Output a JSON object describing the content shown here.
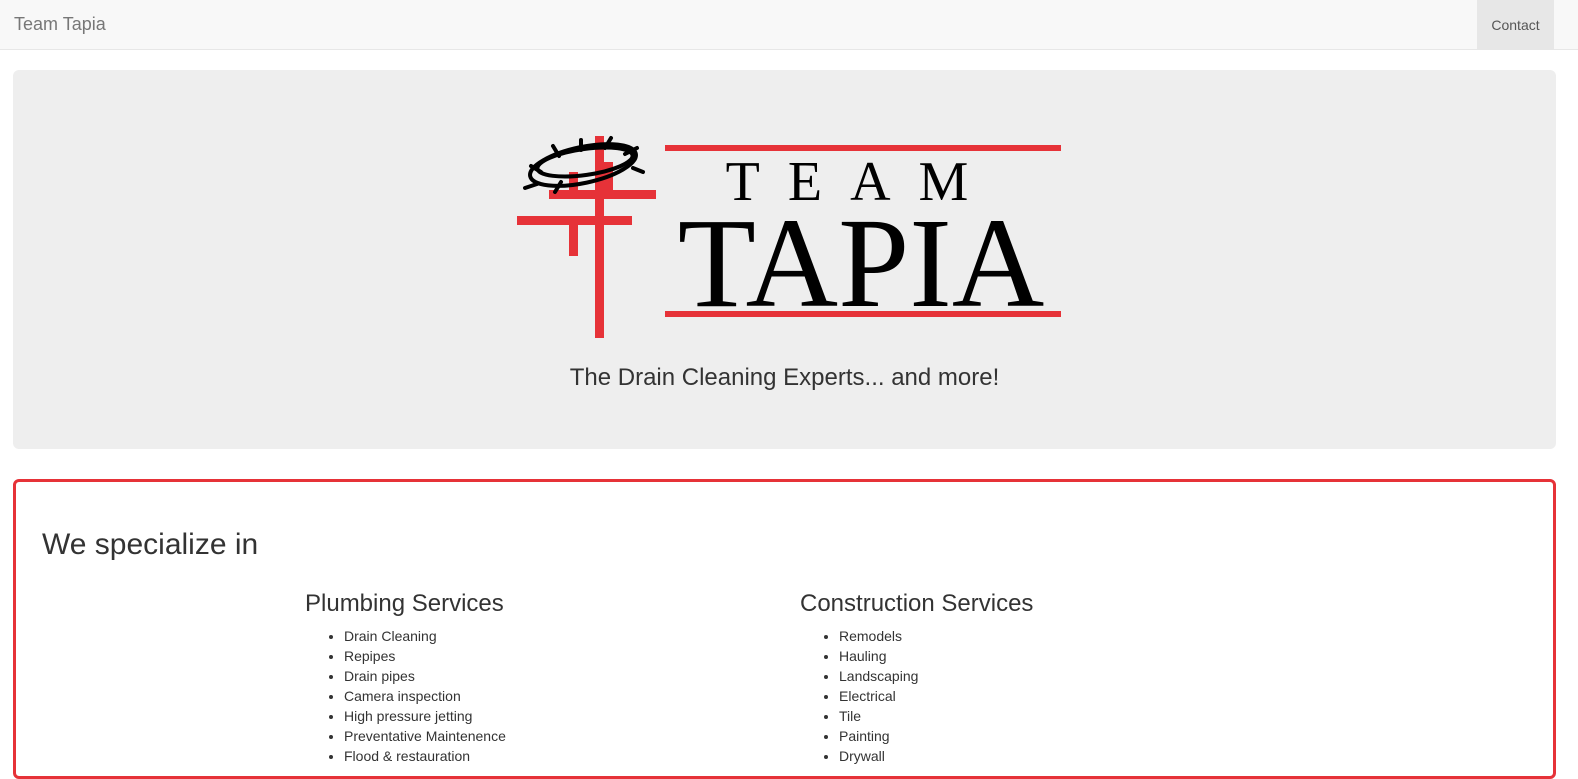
{
  "navbar": {
    "brand": "Team Tapia",
    "contact_label": "Contact"
  },
  "hero": {
    "logo": {
      "team_text": "TEAM",
      "name_text": "TAPIA",
      "accent_color": "#e63238"
    },
    "tagline": "The Drain Cleaning Experts... and more!"
  },
  "services": {
    "heading": "We specialize in",
    "plumbing": {
      "title": "Plumbing Services",
      "items": [
        "Drain Cleaning",
        "Repipes",
        "Drain pipes",
        "Camera inspection",
        "High pressure jetting",
        "Preventative Maintenence",
        "Flood & restauration"
      ]
    },
    "construction": {
      "title": "Construction Services",
      "items": [
        "Remodels",
        "Hauling",
        "Landscaping",
        "Electrical",
        "Tile",
        "Painting",
        "Drywall"
      ]
    },
    "border_color": "#e63238"
  }
}
